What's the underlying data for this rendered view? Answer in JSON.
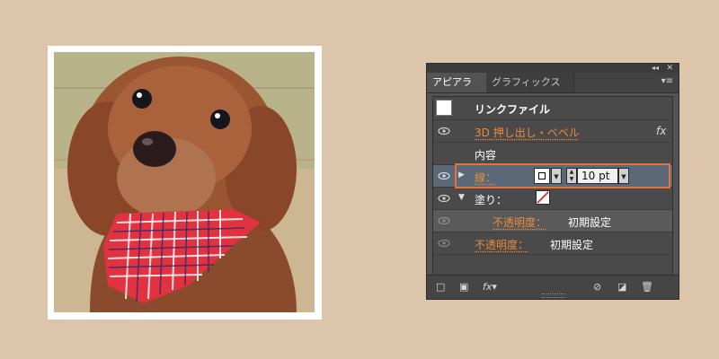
{
  "panel": {
    "tabs": [
      {
        "label": "アピアランス"
      },
      {
        "label": "グラフィックスタイル"
      }
    ],
    "collapse_glyph": "◂◂",
    "close_glyph": "✕",
    "menu_glyph": "▾≡",
    "object_title": "リンクファイル",
    "rows": {
      "effect": {
        "label": "3D 押し出し・ベベル",
        "fx": "fx"
      },
      "contents": {
        "label": "内容"
      },
      "stroke": {
        "label": "線：",
        "weight": "10 pt"
      },
      "fill": {
        "label": "塗り："
      },
      "fill_opacity": {
        "label": "不透明度：",
        "value": "初期設定"
      },
      "opacity": {
        "label": "不透明度：",
        "value": "初期設定"
      }
    },
    "bottom_icons": [
      "new-art-stroke-icon",
      "new-art-fill-icon",
      "fx-menu-icon",
      "clear-appearance-icon",
      "duplicate-item-icon",
      "trash-icon"
    ]
  },
  "colors": {
    "background": "#dcc5ab",
    "panel": "#535353",
    "accent_orange": "#ee8a3a",
    "highlight": "#e8733a",
    "selected_row": "#5b6877"
  }
}
